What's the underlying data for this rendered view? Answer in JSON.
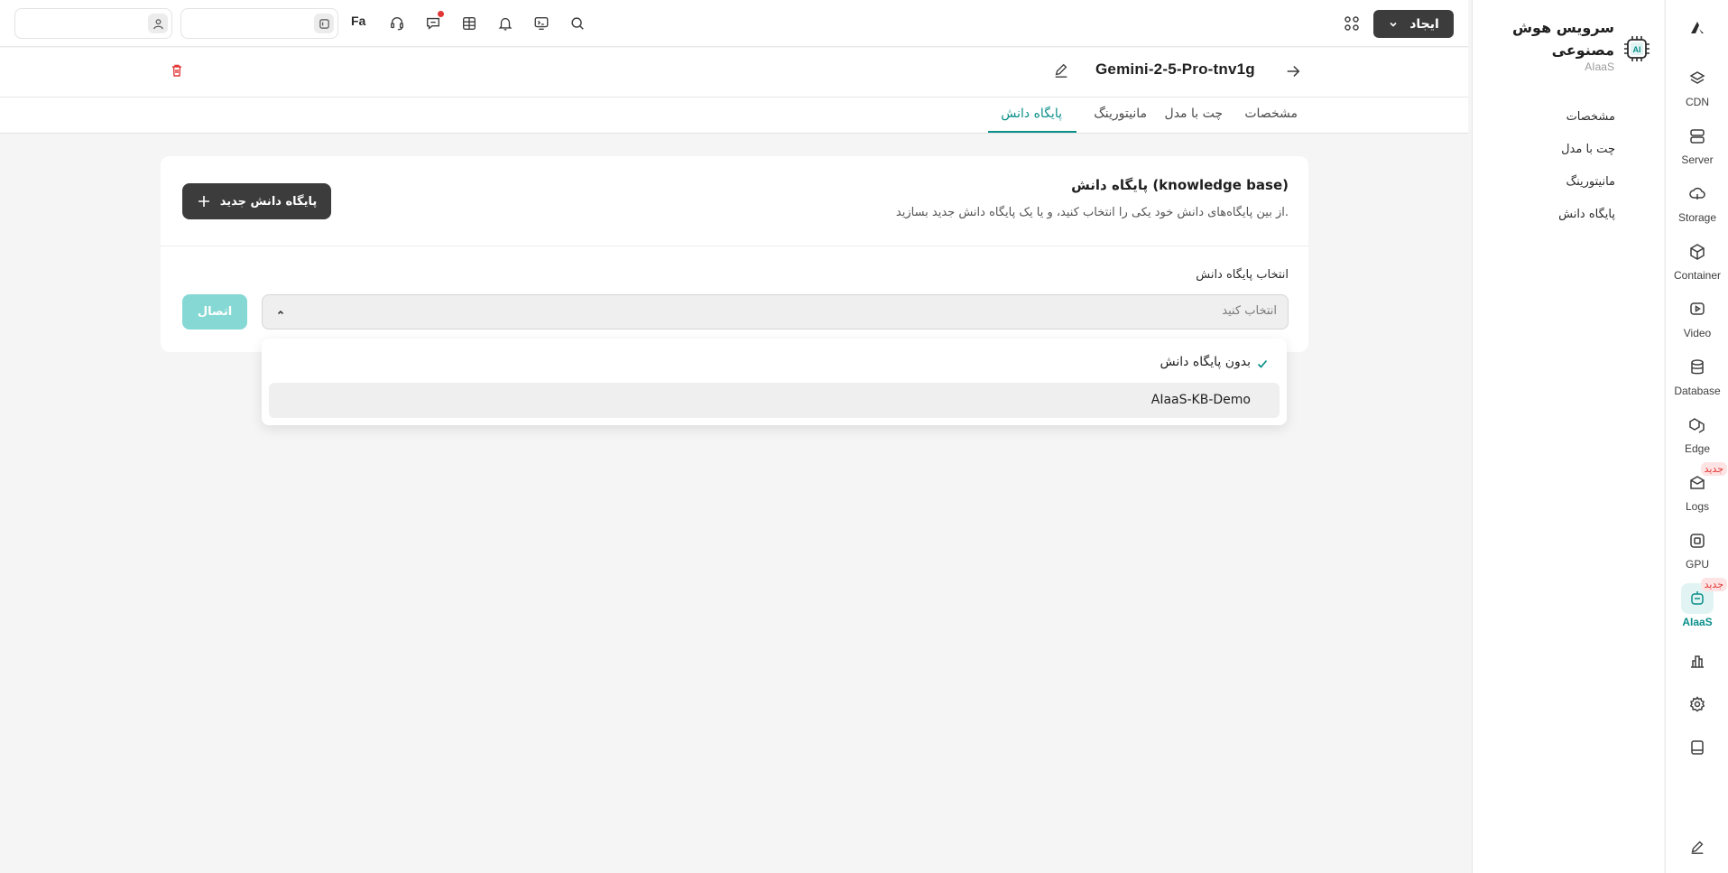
{
  "top_bar": {
    "create_label": "ایجاد",
    "language_label": "Fa",
    "search_value": "",
    "account_value": ""
  },
  "header": {
    "model_title": "Gemini-2-5-Pro-tnv1g"
  },
  "tabs": [
    {
      "label": "مشخصات",
      "active": false
    },
    {
      "label": "چت با مدل",
      "active": false
    },
    {
      "label": "مانیتورینگ",
      "active": false
    },
    {
      "label": "پایگاه دانش",
      "active": true
    }
  ],
  "sidebar": {
    "title": "سرویس هوش مصنوعی",
    "subtitle": "AIaaS",
    "logo_text": "AI",
    "items": [
      {
        "label": "مشخصات"
      },
      {
        "label": "چت با مدل"
      },
      {
        "label": "مانیتورینگ"
      },
      {
        "label": "پایگاه دانش"
      }
    ]
  },
  "rail": {
    "items": [
      {
        "label": "CDN",
        "icon": "cdn-icon"
      },
      {
        "label": "Server",
        "icon": "server-icon"
      },
      {
        "label": "Storage",
        "icon": "storage-icon"
      },
      {
        "label": "Container",
        "icon": "container-icon"
      },
      {
        "label": "Video",
        "icon": "video-icon"
      },
      {
        "label": "Database",
        "icon": "database-icon"
      },
      {
        "label": "Edge",
        "icon": "edge-icon"
      },
      {
        "label": "Logs",
        "icon": "logs-icon",
        "badge": "جدید"
      },
      {
        "label": "GPU",
        "icon": "gpu-icon"
      },
      {
        "label": "AIaaS",
        "icon": "aiaas-icon",
        "badge": "جدید",
        "active": true
      }
    ],
    "new_badge": "جدید"
  },
  "knowledge_base": {
    "title": "پایگاه دانش (knowledge base)",
    "description": "از بین پایگاه‌های دانش خود یکی را انتخاب کنید، و یا یک پایگاه دانش جدید بسازید.",
    "new_button_label": "پایگاه دانش جدید",
    "select_label": "انتخاب پایگاه دانش",
    "select_placeholder": "انتخاب کنید",
    "connect_label": "اتصال",
    "options": [
      {
        "label": "بدون پایگاه دانش",
        "selected": true
      },
      {
        "label": "AIaaS-KB-Demo",
        "selected": false
      }
    ]
  },
  "colors": {
    "accent": "#0a8f8a",
    "dark_button": "#3c3c3c",
    "connect_disabled": "#85d8d4",
    "danger": "#e23636"
  }
}
